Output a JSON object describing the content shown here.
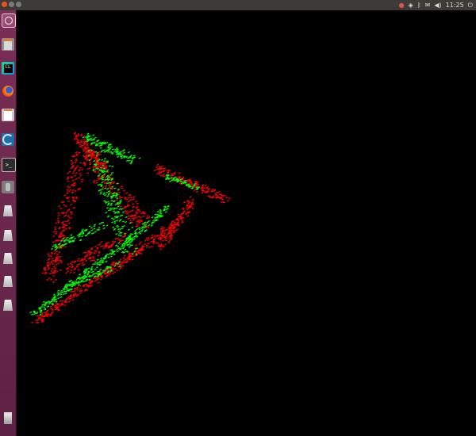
{
  "panel": {
    "clock": "11:25",
    "tray_icons": [
      "recording-icon",
      "network-icon",
      "bluetooth-icon",
      "mail-icon",
      "volume-icon",
      "power-icon"
    ]
  },
  "launcher": {
    "items": [
      {
        "name": "dash-home-icon",
        "glyph": "◎"
      },
      {
        "name": "files-icon",
        "glyph": ""
      },
      {
        "name": "clion-icon",
        "glyph": "CL"
      },
      {
        "name": "firefox-icon",
        "glyph": ""
      },
      {
        "name": "text-editor-icon",
        "glyph": ""
      },
      {
        "name": "cmake-gui-icon",
        "glyph": ""
      },
      {
        "name": "terminal-icon",
        "glyph": ">_"
      },
      {
        "name": "software-updater-icon",
        "glyph": ""
      },
      {
        "name": "drive-1-icon",
        "glyph": ""
      },
      {
        "name": "drive-2-icon",
        "glyph": ""
      },
      {
        "name": "drive-3-icon",
        "glyph": ""
      },
      {
        "name": "drive-4-icon",
        "glyph": ""
      },
      {
        "name": "drive-5-icon",
        "glyph": ""
      },
      {
        "name": "trash-icon",
        "glyph": ""
      }
    ]
  },
  "colors": {
    "cloud_a": "#00ff00",
    "cloud_b": "#ff0000",
    "background": "#000000"
  }
}
